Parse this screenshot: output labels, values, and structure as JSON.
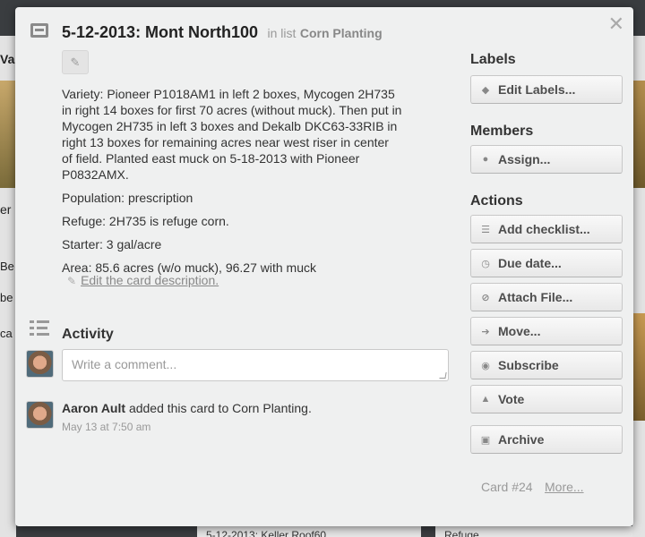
{
  "background": {
    "left_fragments": [
      "Va",
      "er",
      "Be",
      "be",
      "ca"
    ],
    "bottom_cards": [
      "5-12-2013: Keller Roof60",
      "Refuge"
    ]
  },
  "card": {
    "title": "5-12-2013: Mont North100",
    "in_list_label": "in list",
    "list_name": "Corn Planting",
    "description": [
      "Variety: Pioneer P1018AM1 in left 2 boxes, Mycogen 2H735 in right 14 boxes for first 70 acres (without muck). Then put in Mycogen 2H735 in left 3 boxes and Dekalb DKC63-33RIB in right 13 boxes for remaining acres near west riser in center of field. Planted east muck on 5-18-2013 with Pioneer P0832AMX.",
      "Population: prescription",
      "Refuge: 2H735 is refuge corn.",
      "Starter: 3 gal/acre",
      "Area: 85.6 acres (w/o muck), 96.27 with muck"
    ],
    "edit_description_label": "Edit the card description."
  },
  "activity": {
    "heading": "Activity",
    "comment_placeholder": "Write a comment...",
    "entries": [
      {
        "user": "Aaron Ault",
        "action": "added this card to Corn Planting.",
        "time": "May 13 at 7:50 am"
      }
    ]
  },
  "sidebar": {
    "labels_heading": "Labels",
    "edit_labels": "Edit Labels...",
    "members_heading": "Members",
    "assign": "Assign...",
    "actions_heading": "Actions",
    "actions": [
      "Add checklist...",
      "Due date...",
      "Attach File...",
      "Move...",
      "Subscribe",
      "Vote"
    ],
    "archive": "Archive",
    "card_number": "Card #24",
    "more": "More..."
  },
  "colors": {
    "modal_bg": "#eff0f0",
    "overlay_bg": "#3a3d40",
    "button_text": "#4d4d4d"
  }
}
